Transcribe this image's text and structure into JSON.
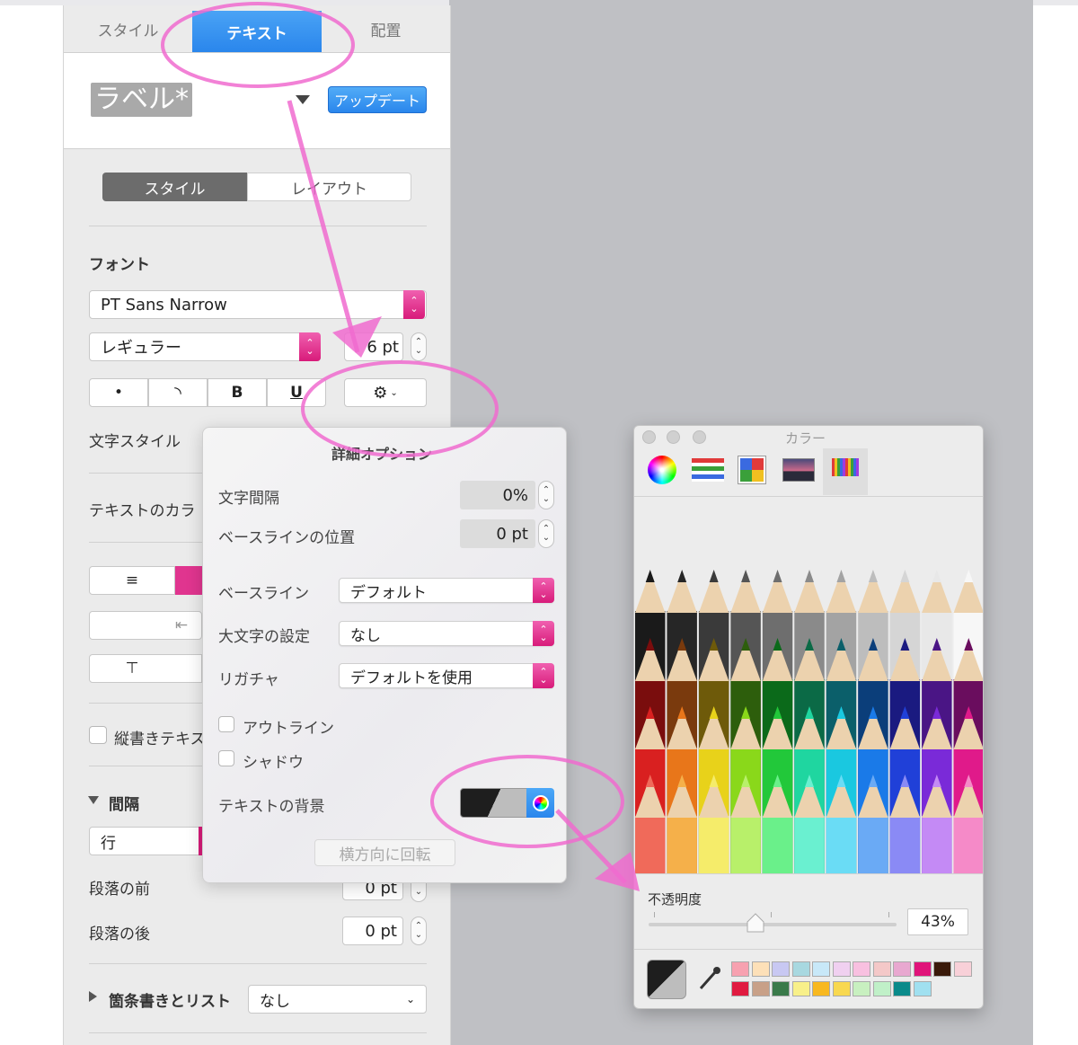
{
  "tabs": {
    "style": "スタイル",
    "text": "テキスト",
    "arrange": "配置"
  },
  "paragraph_style": {
    "name": "ラベル*",
    "update": "アップデート"
  },
  "segment": {
    "style": "スタイル",
    "layout": "レイアウト"
  },
  "font": {
    "heading": "フォント",
    "family": "PT Sans Narrow",
    "weight": "レギュラー",
    "size": "6 pt",
    "style_buttons": [
      "•",
      "◝",
      "B",
      "U"
    ],
    "char_style_label": "文字スタイル",
    "text_color_label": "テキストのカラ"
  },
  "vertical_text": "縦書きテキス",
  "spacing": {
    "heading": "間隔",
    "line": "行",
    "before_label": "段落の前",
    "before_value": "0 pt",
    "after_label": "段落の後",
    "after_value": "0 pt"
  },
  "bullets": {
    "heading": "箇条書きとリスト",
    "value": "なし"
  },
  "popover": {
    "title": "詳細オプション",
    "char_spacing_label": "文字間隔",
    "char_spacing_value": "0%",
    "baseline_shift_label": "ベースラインの位置",
    "baseline_shift_value": "0 pt",
    "baseline_label": "ベースライン",
    "baseline_value": "デフォルト",
    "caps_label": "大文字の設定",
    "caps_value": "なし",
    "ligature_label": "リガチャ",
    "ligature_value": "デフォルトを使用",
    "outline_label": "アウトライン",
    "shadow_label": "シャドウ",
    "background_label": "テキストの背景",
    "rotate_button": "横方向に回転"
  },
  "color_panel": {
    "title": "カラー",
    "opacity_label": "不透明度",
    "opacity_value": "43%",
    "opacity_fraction": 0.43,
    "pencils": [
      "#1a1a1a",
      "#262626",
      "#3a3a3a",
      "#555555",
      "#6e6e6e",
      "#8a8a8a",
      "#a3a3a3",
      "#bdbdbd",
      "#d5d5d5",
      "#e8e8e8",
      "#f7f7f7",
      "#7a0d0d",
      "#7a3a0d",
      "#6e5a0a",
      "#2d5e0c",
      "#0b6a1a",
      "#0b6a46",
      "#0b5f6a",
      "#0b3e7a",
      "#1a1a80",
      "#4a1585",
      "#6a0d5e",
      "#d92020",
      "#e8761a",
      "#e8d21a",
      "#8ad81a",
      "#22c83a",
      "#1fd6a0",
      "#1ac8e0",
      "#1a7ae8",
      "#2040d8",
      "#7a2ad8",
      "#e01a8a",
      "#f06a5a",
      "#f5b04a",
      "#f5ec6a",
      "#b8f06a",
      "#6af08a",
      "#6af0d0",
      "#6adcf5",
      "#6aaaf5",
      "#8a8af5",
      "#c48af5",
      "#f58ac8"
    ],
    "swatches": [
      "#f7a1b0",
      "#fde0b8",
      "#c8c8f2",
      "#a8d8e0",
      "#c8e8f8",
      "#f0d0f0",
      "#f8c0e0",
      "#f4c8c8",
      "#e8a8d0",
      "#e0147a",
      "#3a1a0a",
      "#f8d0d8",
      "#e01a40",
      "#c8a088",
      "#3a7a4a",
      "#f8f08a",
      "#f8b820",
      "#f8d850",
      "#c8f0c0",
      "#c0f0c8",
      "#0a8a8a",
      "#a0e0f0"
    ]
  }
}
